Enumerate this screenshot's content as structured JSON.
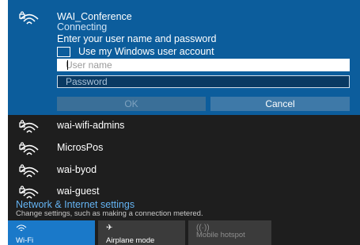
{
  "active_network": {
    "name": "WAI_Conference",
    "status": "Connecting",
    "prompt": "Enter your user name and password",
    "use_windows_account_label": "Use my Windows user account",
    "username_placeholder": "User name",
    "password_placeholder": "Password",
    "ok_label": "OK",
    "cancel_label": "Cancel"
  },
  "networks": [
    {
      "name": "wai-wifi-admins",
      "icon": "wifi-secured-icon"
    },
    {
      "name": "MicrosPos",
      "icon": "wifi-secured-icon"
    },
    {
      "name": "wai-byod",
      "icon": "wifi-secured-icon"
    },
    {
      "name": "wai-guest",
      "icon": "wifi-secured-icon"
    }
  ],
  "settings": {
    "link": "Network & Internet settings",
    "description": "Change settings, such as making a connection metered."
  },
  "quick_actions": [
    {
      "label": "Wi-Fi",
      "icon": "wifi-icon",
      "active": true
    },
    {
      "label": "Airplane mode",
      "icon": "airplane-icon",
      "active": false
    },
    {
      "label": "Mobile hotspot",
      "icon": "hotspot-icon",
      "active": false,
      "disabled": true
    }
  ],
  "colors": {
    "accent": "#0c5d9c",
    "flyout_background": "#1e1e1e",
    "link": "#64b3f2",
    "tile_active": "#1a79c9",
    "tile_inactive": "#3b3b3b"
  }
}
